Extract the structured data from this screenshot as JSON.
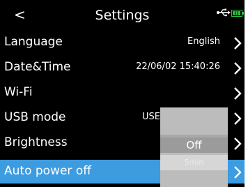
{
  "header": {
    "title": "Settings",
    "back_icon": "chevron-left-icon",
    "status_icons": [
      "usb-icon",
      "battery-icon"
    ]
  },
  "settings": [
    {
      "label": "Language",
      "value": "English"
    },
    {
      "label": "Date&Time",
      "value": "22/06/02 15:40:26"
    },
    {
      "label": "Wi-Fi",
      "value": ""
    },
    {
      "label": "USB mode",
      "value": "USE"
    },
    {
      "label": "Brightness",
      "value": ""
    },
    {
      "label": "Auto power off",
      "value": ""
    }
  ],
  "selected_index": 5,
  "popup": {
    "selected_option": "Off",
    "next_option": "5min"
  },
  "colors": {
    "background": "#000000",
    "selected_row": "#3d9be0",
    "text": "#ffffff",
    "popup": "#bcbcbc"
  }
}
